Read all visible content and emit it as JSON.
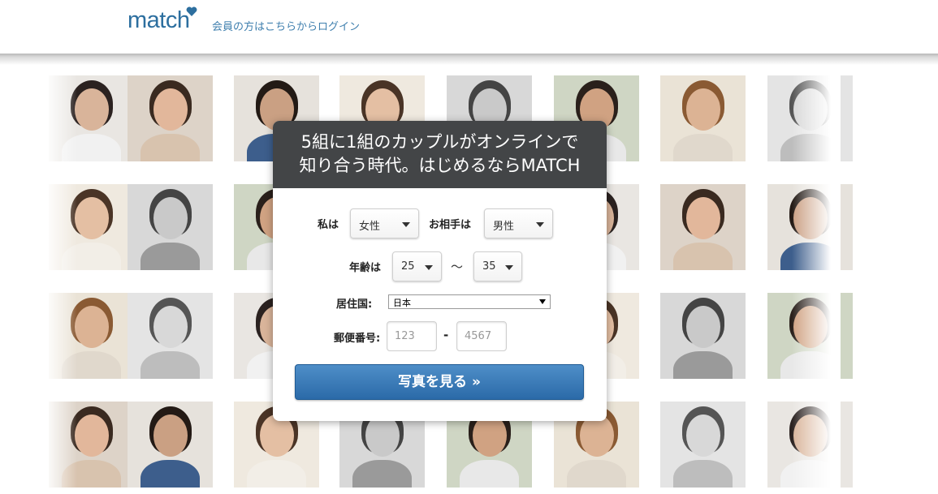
{
  "header": {
    "logo_text": "match",
    "login_link": "会員の方はこちらからログイン"
  },
  "modal": {
    "title_line1": "5組に1組のカップルがオンラインで",
    "title_line2": "知り合う時代。はじめるならMATCH",
    "i_am_label": "私は",
    "i_am_value": "女性",
    "seeking_label": "お相手は",
    "seeking_value": "男性",
    "age_label": "年齢は",
    "age_min": "25",
    "age_separator": "～",
    "age_max": "35",
    "country_label": "居住国:",
    "country_value": "日本",
    "zip_label": "郵便番号:",
    "zip1_placeholder": "123",
    "zip_dash": "-",
    "zip2_placeholder": "4567",
    "submit_label": "写真を見る »"
  },
  "colors": {
    "brand_blue": "#2d6f9f",
    "modal_header": "#434547",
    "button_blue": "#3a7bb8"
  }
}
